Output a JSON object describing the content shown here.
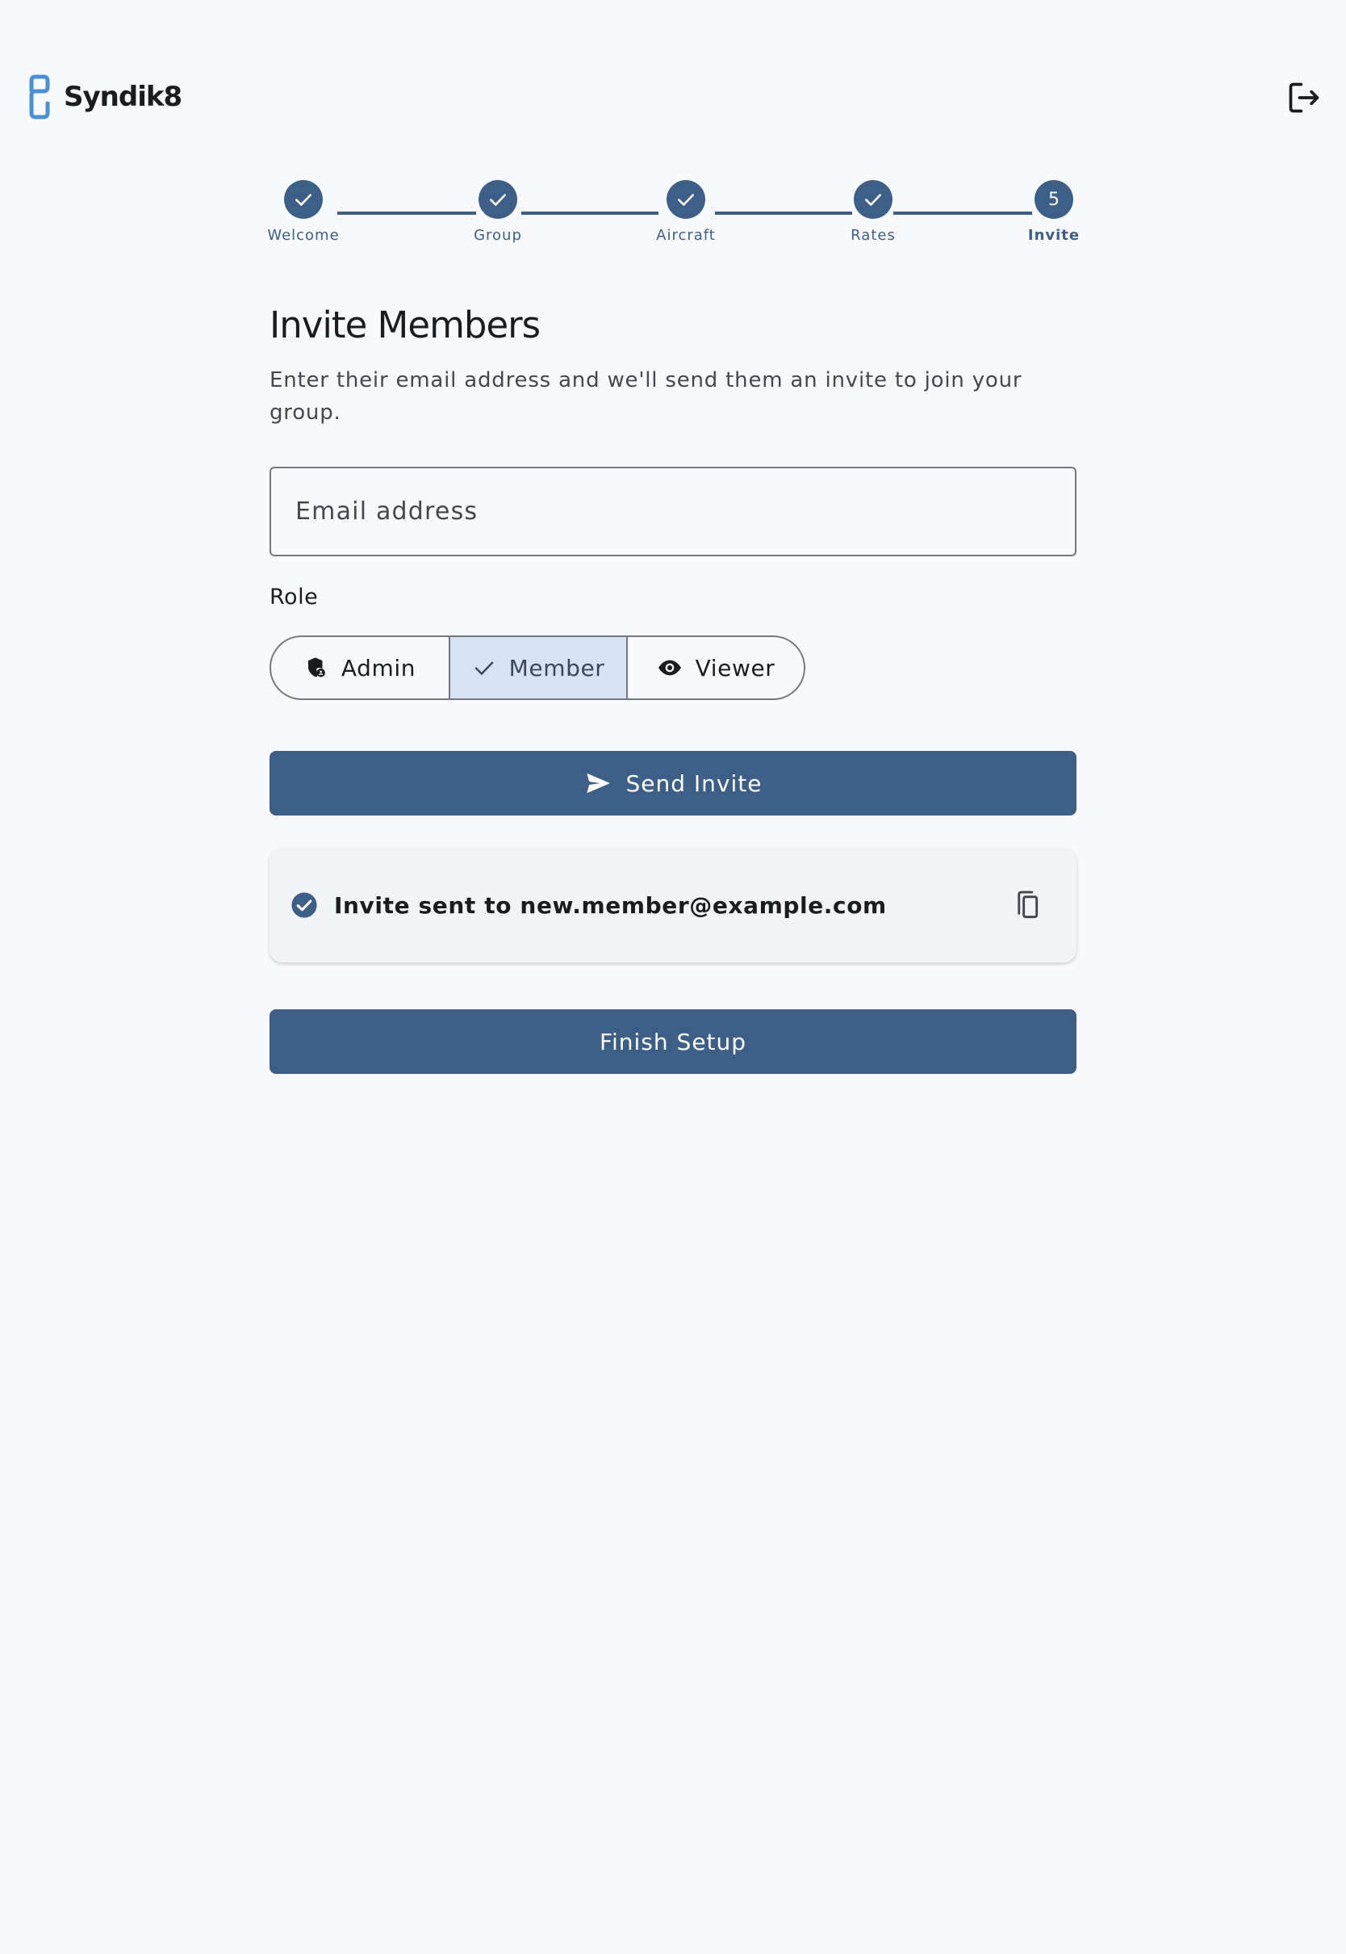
{
  "app": {
    "name": "Syndik8",
    "logo_icon": "syndik8-s-logo",
    "logout_icon": "logout-icon"
  },
  "stepper": {
    "steps": [
      {
        "label": "Welcome",
        "state": "complete",
        "icon": "check-icon"
      },
      {
        "label": "Group",
        "state": "complete",
        "icon": "check-icon"
      },
      {
        "label": "Aircraft",
        "state": "complete",
        "icon": "check-icon"
      },
      {
        "label": "Rates",
        "state": "complete",
        "icon": "check-icon"
      },
      {
        "label": "Invite",
        "state": "active",
        "number": "5"
      }
    ]
  },
  "main": {
    "title": "Invite Members",
    "subtitle": "Enter their email address and we'll send them an invite to join your group.",
    "email": {
      "placeholder": "Email address",
      "value": ""
    },
    "role": {
      "label": "Role",
      "options": [
        {
          "label": "Admin",
          "icon": "admin-shield-icon",
          "selected": false
        },
        {
          "label": "Member",
          "icon": "check-icon",
          "selected": true
        },
        {
          "label": "Viewer",
          "icon": "eye-icon",
          "selected": false
        }
      ]
    },
    "send_button": {
      "label": "Send Invite",
      "icon": "send-icon"
    },
    "invite_status": {
      "text": "Invite sent to new.member@example.com",
      "icon": "check-circle-icon",
      "action_icon": "copy-icon"
    },
    "finish_button": {
      "label": "Finish Setup"
    }
  },
  "colors": {
    "primary": "#3d5f87",
    "background": "#f8f9fd",
    "selected_segment": "#d6e3f7",
    "logo_accent": "#4a90d9"
  }
}
